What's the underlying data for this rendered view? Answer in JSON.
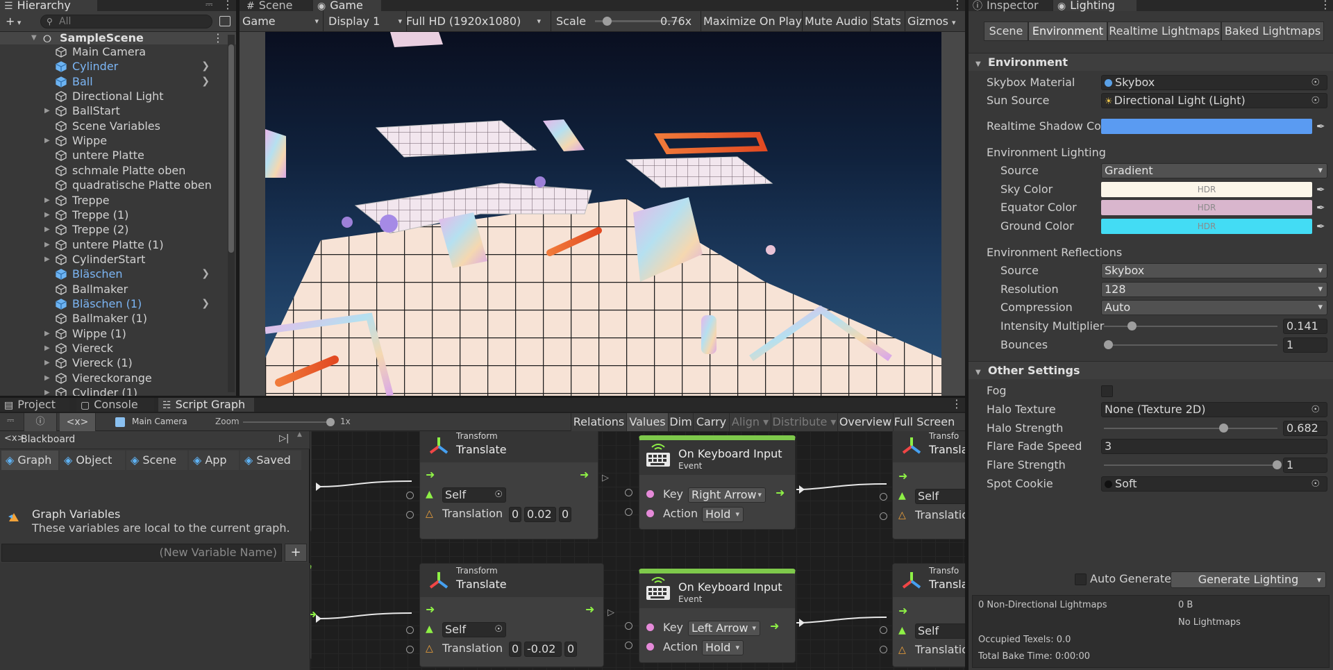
{
  "hierarchy": {
    "tab_label": "Hierarchy",
    "search_placeholder": "All",
    "scene_name": "SampleScene",
    "items": [
      {
        "label": "Main Camera",
        "blue": false,
        "expand": false,
        "chevron": false
      },
      {
        "label": "Cylinder",
        "blue": true,
        "expand": false,
        "chevron": true
      },
      {
        "label": "Ball",
        "blue": true,
        "expand": false,
        "chevron": true
      },
      {
        "label": "Directional Light",
        "blue": false,
        "expand": false,
        "chevron": false
      },
      {
        "label": "BallStart",
        "blue": false,
        "expand": true,
        "chevron": false
      },
      {
        "label": "Scene Variables",
        "blue": false,
        "expand": false,
        "chevron": false
      },
      {
        "label": "Wippe",
        "blue": false,
        "expand": true,
        "chevron": false
      },
      {
        "label": "untere Platte",
        "blue": false,
        "expand": false,
        "chevron": false
      },
      {
        "label": "schmale Platte oben",
        "blue": false,
        "expand": false,
        "chevron": false
      },
      {
        "label": "quadratische Platte oben",
        "blue": false,
        "expand": false,
        "chevron": false
      },
      {
        "label": "Treppe",
        "blue": false,
        "expand": true,
        "chevron": false
      },
      {
        "label": "Treppe (1)",
        "blue": false,
        "expand": true,
        "chevron": false
      },
      {
        "label": "Treppe (2)",
        "blue": false,
        "expand": true,
        "chevron": false
      },
      {
        "label": "untere Platte (1)",
        "blue": false,
        "expand": true,
        "chevron": false
      },
      {
        "label": "CylinderStart",
        "blue": false,
        "expand": true,
        "chevron": false
      },
      {
        "label": "Bläschen",
        "blue": true,
        "expand": false,
        "chevron": true
      },
      {
        "label": "Ballmaker",
        "blue": false,
        "expand": false,
        "chevron": false
      },
      {
        "label": "Bläschen (1)",
        "blue": true,
        "expand": false,
        "chevron": true
      },
      {
        "label": "Ballmaker (1)",
        "blue": false,
        "expand": false,
        "chevron": false
      },
      {
        "label": "Wippe (1)",
        "blue": false,
        "expand": true,
        "chevron": false
      },
      {
        "label": "Viereck",
        "blue": false,
        "expand": true,
        "chevron": false
      },
      {
        "label": "Viereck (1)",
        "blue": false,
        "expand": true,
        "chevron": false
      },
      {
        "label": "Viereckorange",
        "blue": false,
        "expand": true,
        "chevron": false
      },
      {
        "label": "Cylinder (1)",
        "blue": false,
        "expand": true,
        "chevron": false
      }
    ]
  },
  "game": {
    "tab_scene": "Scene",
    "tab_game": "Game",
    "mode": "Game",
    "display": "Display 1",
    "resolution": "Full HD (1920x1080)",
    "scale_label": "Scale",
    "scale_value": "0.76x",
    "scale_fraction": 0.1,
    "maximize": "Maximize On Play",
    "mute": "Mute Audio",
    "stats": "Stats",
    "gizmos": "Gizmos"
  },
  "inspector": {
    "tab_inspector": "Inspector",
    "tab_lighting": "Lighting",
    "subtabs": [
      "Scene",
      "Environment",
      "Realtime Lightmaps",
      "Baked Lightmaps"
    ],
    "env_header": "Environment",
    "skybox_material_label": "Skybox Material",
    "skybox_material_value": "Skybox",
    "sun_source_label": "Sun Source",
    "sun_source_value": "Directional Light (Light)",
    "shadow_color_label": "Realtime Shadow Col",
    "shadow_color": "#5a9bf2",
    "env_lighting_label": "Environment Lighting",
    "source_label": "Source",
    "source_value": "Gradient",
    "sky_color_label": "Sky Color",
    "sky_color": "#fbf6e9",
    "equator_color_label": "Equator Color",
    "equator_color": "#d9b6cd",
    "ground_color_label": "Ground Color",
    "ground_color": "#43dcf4",
    "hdr": "HDR",
    "env_reflections_label": "Environment Reflections",
    "refl_source_label": "Source",
    "refl_source_value": "Skybox",
    "resolution_label": "Resolution",
    "resolution_value": "128",
    "compression_label": "Compression",
    "compression_value": "Auto",
    "intensity_label": "Intensity Multiplier",
    "intensity_value": "0.141",
    "intensity_fraction": 0.141,
    "bounces_label": "Bounces",
    "bounces_value": "1",
    "bounces_fraction": 0.0,
    "other_header": "Other Settings",
    "fog_label": "Fog",
    "halo_texture_label": "Halo Texture",
    "halo_texture_value": "None (Texture 2D)",
    "halo_strength_label": "Halo Strength",
    "halo_strength_value": "0.682",
    "halo_strength_fraction": 0.682,
    "flare_fade_label": "Flare Fade Speed",
    "flare_fade_value": "3",
    "flare_strength_label": "Flare Strength",
    "flare_strength_value": "1",
    "flare_strength_fraction": 1.0,
    "spot_cookie_label": "Spot Cookie",
    "spot_cookie_value": "Soft",
    "auto_generate_label": "Auto Generate",
    "generate_button": "Generate Lighting",
    "stats_lightmaps": "0 Non-Directional Lightmaps",
    "stats_size": "0 B",
    "stats_none": "No Lightmaps",
    "stats_texels": "Occupied Texels: 0.0",
    "stats_time": "Total Bake Time: 0:00:00"
  },
  "bottom": {
    "tab_project": "Project",
    "tab_console": "Console",
    "tab_scriptgraph": "Script Graph",
    "object_name": "Main Camera",
    "zoom_label": "Zoom",
    "zoom_value": "1x",
    "toolbar": [
      "Relations",
      "Values",
      "Dim",
      "Carry",
      "Align",
      "Distribute",
      "Overview",
      "Full Screen"
    ],
    "blackboard_label": "Blackboard",
    "bb_tabs": [
      "Graph",
      "Object",
      "Scene",
      "App",
      "Saved"
    ],
    "graph_vars_title": "Graph Variables",
    "graph_vars_desc": "These variables are local to the current graph.",
    "new_var_placeholder": "(New Variable Name)"
  },
  "nodes": {
    "translate1": {
      "kind": "Transform",
      "title": "Translate",
      "self": "Self",
      "translation_label": "Translation",
      "x": "0",
      "y": "0.02",
      "z": "0"
    },
    "keyboard1": {
      "title": "On Keyboard Input",
      "sub": "Event",
      "key_label": "Key",
      "key_value": "Right Arrow",
      "action_label": "Action",
      "action_value": "Hold"
    },
    "translate_r1": {
      "kind": "Transfo",
      "title": "Transla",
      "self": "Self",
      "translation_label": "Translatio"
    },
    "translate2": {
      "kind": "Transform",
      "title": "Translate",
      "self": "Self",
      "translation_label": "Translation",
      "x": "0",
      "y": "-0.02",
      "z": "0"
    },
    "keyboard2": {
      "title": "On Keyboard Input",
      "sub": "Event",
      "key_label": "Key",
      "key_value": "Left Arrow",
      "action_label": "Action",
      "action_value": "Hold"
    },
    "translate_r2": {
      "kind": "Transfo",
      "title": "Transla",
      "self": "Self",
      "translation_label": "Translatio"
    }
  }
}
